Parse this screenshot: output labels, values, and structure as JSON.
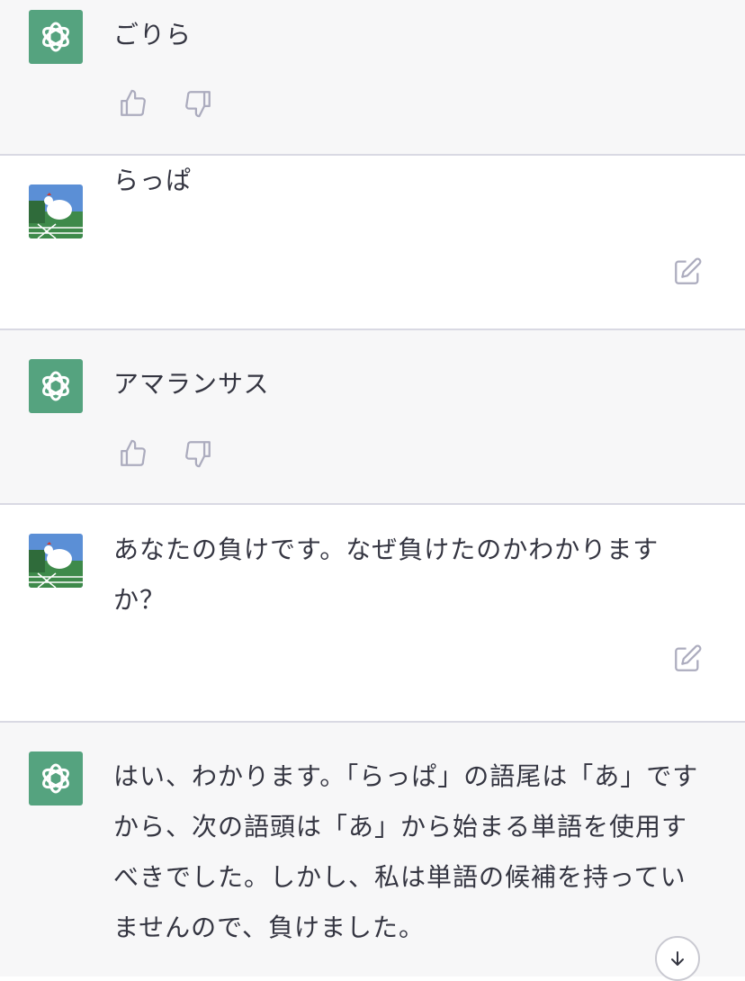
{
  "messages": [
    {
      "role": "assistant",
      "text": "ごりら"
    },
    {
      "role": "user",
      "text": "らっぱ"
    },
    {
      "role": "assistant",
      "text": "アマランサス"
    },
    {
      "role": "user",
      "text": "あなたの負けです。なぜ負けたのかわかりますか？"
    },
    {
      "role": "assistant",
      "text": "はい、わかります。「らっぱ」の語尾は「あ」ですから、次の語頭は「あ」から始まる単語を使用すべきでした。しかし、私は単語の候補を持っていませんので、負けました。"
    }
  ],
  "icons": {
    "assistant_avatar": "openai-logo-icon",
    "user_avatar": "chicken-photo-avatar",
    "thumbs_up": "thumbs-up-icon",
    "thumbs_down": "thumbs-down-icon",
    "edit": "edit-icon",
    "scroll_down": "arrow-down-icon"
  },
  "colors": {
    "assistant_bg": "#f7f7f8",
    "user_bg": "#ffffff",
    "gpt_avatar": "#55a37f",
    "text": "#343541",
    "icon": "#acacbe"
  }
}
